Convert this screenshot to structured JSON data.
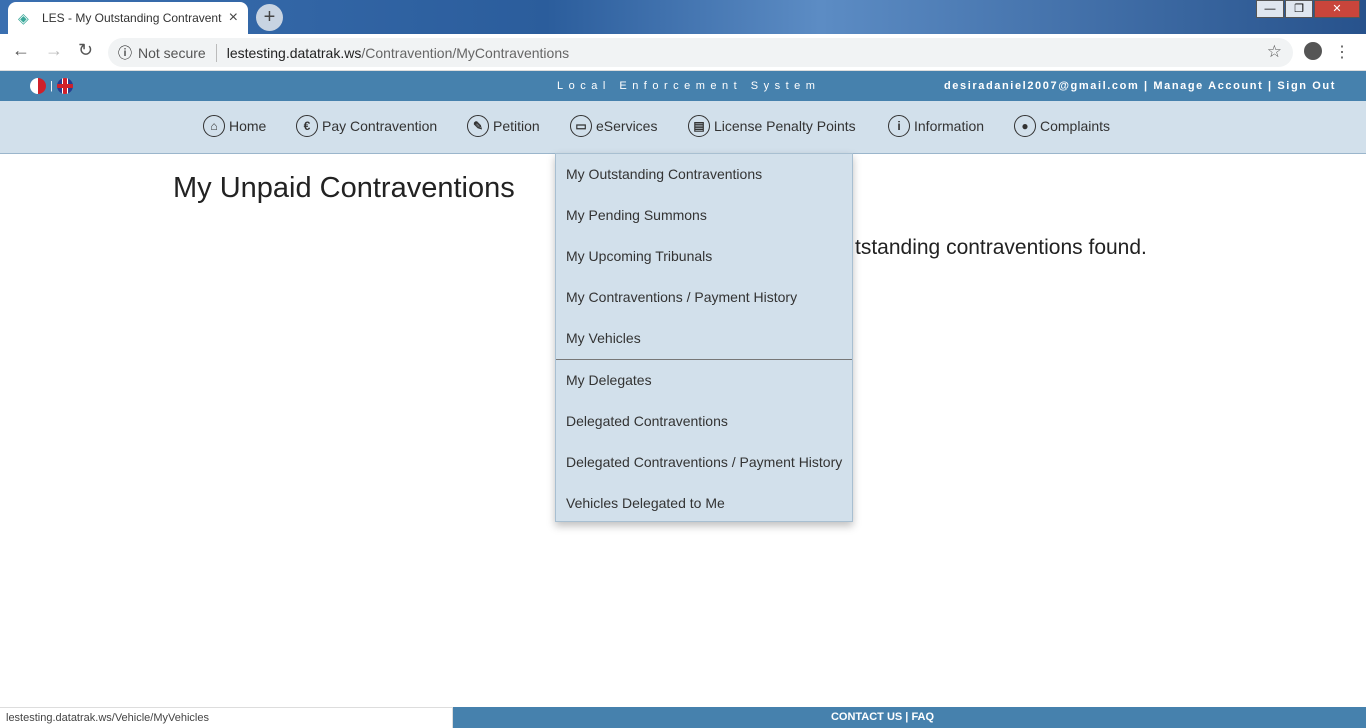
{
  "browser": {
    "tab_title": "LES - My Outstanding Contravent",
    "security": "Not secure",
    "url_host": "lestesting.datatrak.ws",
    "url_path": "/Contravention/MyContraventions",
    "status_url": "lestesting.datatrak.ws/Vehicle/MyVehicles"
  },
  "topbar": {
    "system_name": "Local Enforcement System",
    "email": "desiradaniel2007@gmail.com",
    "manage": "Manage Account",
    "signout": "Sign Out",
    "sep": " | "
  },
  "nav": [
    {
      "label": "Home",
      "icon": "home-icon",
      "glyph": "⌂"
    },
    {
      "label": "Pay Contravention",
      "icon": "euro-icon",
      "glyph": "€"
    },
    {
      "label": "Petition",
      "icon": "edit-icon",
      "glyph": "✎"
    },
    {
      "label": "eServices",
      "icon": "laptop-icon",
      "glyph": "▭"
    },
    {
      "label": "License Penalty Points",
      "icon": "id-card-icon",
      "glyph": "▤"
    },
    {
      "label": "Information",
      "icon": "info-icon",
      "glyph": "i"
    },
    {
      "label": "Complaints",
      "icon": "comments-icon",
      "glyph": "●"
    }
  ],
  "page": {
    "title": "My Unpaid Contraventions",
    "message": "tstanding contraventions found."
  },
  "dropdown": {
    "group1": [
      "My Outstanding Contraventions",
      "My Pending Summons",
      "My Upcoming Tribunals",
      "My Contraventions / Payment History",
      "My Vehicles"
    ],
    "group2": [
      "My Delegates",
      "Delegated Contraventions",
      "Delegated Contraventions / Payment History",
      "Vehicles Delegated to Me"
    ]
  },
  "footer": {
    "contact": "CONTACT US",
    "sep": " | ",
    "faq": "FAQ"
  },
  "colors": {
    "brand": "#4681ad",
    "nav_bg": "#d2e0eb"
  }
}
